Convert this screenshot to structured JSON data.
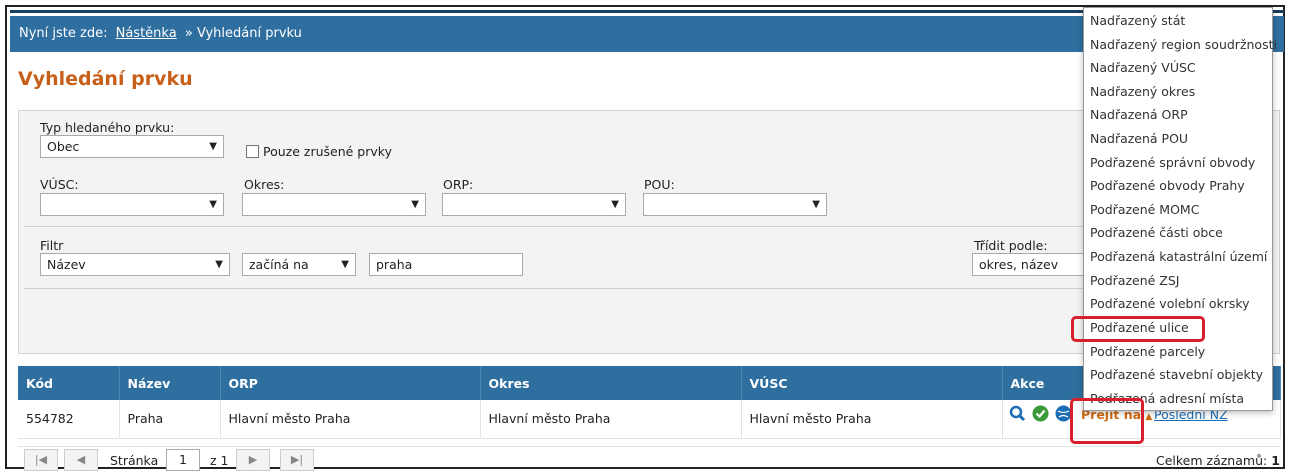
{
  "breadcrumb": {
    "prefix": "Nyní jste zde:",
    "home": "Nástěnka",
    "separator": "»",
    "current": "Vyhledání prvku"
  },
  "page_title": "Vyhledání prvku",
  "form": {
    "type_label": "Typ hledaného prvku:",
    "type_value": "Obec",
    "cancelled_label": "Pouze zrušené prvky",
    "vusc_label": "VÚSC:",
    "okres_label": "Okres:",
    "orp_label": "ORP:",
    "pou_label": "POU:",
    "filter_label": "Filtr",
    "filter_field": "Název",
    "filter_op": "začíná na",
    "filter_value": "praha",
    "sort_label": "Třídit podle:",
    "sort_value": "okres, název"
  },
  "table": {
    "headers": [
      "Kód",
      "Název",
      "ORP",
      "Okres",
      "VÚSC",
      "Akce"
    ],
    "row": {
      "kod": "554782",
      "nazev": "Praha",
      "orp": "Hlavní město Praha",
      "okres": "Hlavní město Praha",
      "vusc": "Hlavní město Praha"
    },
    "goto_label": "Přejít na",
    "last_nz": "Poslední NZ"
  },
  "pager": {
    "page_label": "Stránka",
    "page": "1",
    "of_label": "z 1",
    "total_label": "Celkem záznamů:",
    "total": "1"
  },
  "dropdown": [
    "Nadřazený stát",
    "Nadřazený region soudržnosti",
    "Nadřazený VÚSC",
    "Nadřazený okres",
    "Nadřazená ORP",
    "Nadřazená POU",
    "Podřazené správní obvody",
    "Podřazené obvody Prahy",
    "Podřazené MOMC",
    "Podřazené části obce",
    "Podřazená katastrální území",
    "Podřazené ZSJ",
    "Podřazené volební okrsky",
    "Podřazené ulice",
    "Podřazené parcely",
    "Podřazené stavební objekty",
    "Podřazená adresní místa"
  ],
  "colors": {
    "header_blue": "#2f6fa0",
    "title_orange": "#c75f1a",
    "highlight_red": "#d8202c"
  }
}
